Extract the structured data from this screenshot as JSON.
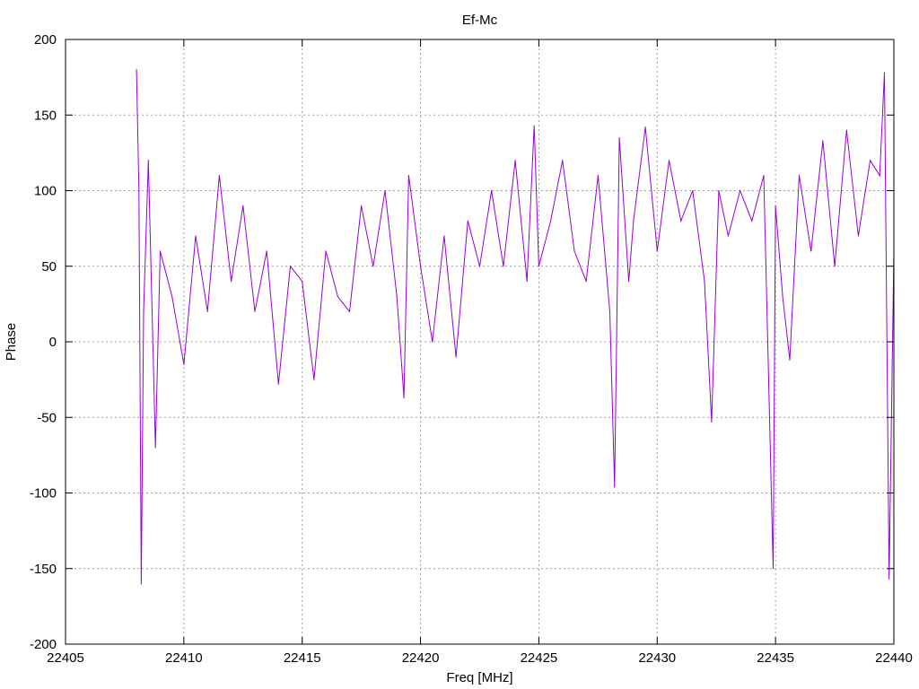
{
  "chart_data": {
    "type": "line",
    "title": "Ef-Mc",
    "xlabel": "Freq [MHz]",
    "ylabel": "Phase",
    "xlim": [
      22405,
      22440
    ],
    "ylim": [
      -200,
      200
    ],
    "xticks": [
      22405,
      22410,
      22415,
      22420,
      22425,
      22430,
      22435,
      22440
    ],
    "yticks": [
      -200,
      -150,
      -100,
      -50,
      0,
      50,
      100,
      150,
      200
    ],
    "xtick_labels": [
      "22405",
      "22410",
      "22415",
      "22420",
      "22425",
      "22430",
      "22435",
      "22440"
    ],
    "ytick_labels": [
      "-200",
      "-150",
      "-100",
      "-50",
      "0",
      "50",
      "100",
      "150",
      "200"
    ],
    "grid": true,
    "line_color": "#9400d3",
    "series": [
      {
        "x": [
          22408.0,
          22408.1,
          22408.2,
          22408.3,
          22408.5,
          22408.8,
          22409.0,
          22409.5,
          22410.0,
          22410.5,
          22411.0,
          22411.5,
          22412.0,
          22412.5,
          22413.0,
          22413.5,
          22414.0,
          22414.5,
          22415.0,
          22415.5,
          22416.0,
          22416.5,
          22417.0,
          22417.5,
          22418.0,
          22418.5,
          22419.0,
          22419.3,
          22419.5,
          22420.0,
          22420.5,
          22421.0,
          22421.5,
          22422.0,
          22422.5,
          22423.0,
          22423.5,
          22424.0,
          22424.5,
          22424.8,
          22425.0,
          22425.5,
          22426.0,
          22426.5,
          22427.0,
          22427.5,
          22428.0,
          22428.2,
          22428.4,
          22428.8,
          22429.0,
          22429.5,
          22430.0,
          22430.5,
          22431.0,
          22431.5,
          22432.0,
          22432.3,
          22432.6,
          22433.0,
          22433.5,
          22434.0,
          22434.5,
          22434.9,
          22435.0,
          22435.3,
          22435.6,
          22436.0,
          22436.5,
          22437.0,
          22437.5,
          22438.0,
          22438.5,
          22439.0,
          22439.4,
          22439.6,
          22439.8,
          22440.0
        ],
        "y": [
          180,
          100,
          -160,
          20,
          120,
          -70,
          60,
          30,
          -15,
          70,
          20,
          110,
          40,
          90,
          20,
          60,
          -28,
          50,
          40,
          -25,
          60,
          30,
          20,
          90,
          50,
          100,
          30,
          -37,
          110,
          50,
          0,
          70,
          -10,
          80,
          50,
          100,
          50,
          120,
          40,
          143,
          50,
          80,
          120,
          60,
          40,
          110,
          20,
          -96,
          135,
          40,
          80,
          142,
          60,
          120,
          80,
          100,
          40,
          -53,
          100,
          70,
          100,
          80,
          110,
          -150,
          90,
          30,
          -12,
          110,
          60,
          133,
          50,
          140,
          70,
          120,
          110,
          178,
          -157,
          60
        ]
      }
    ]
  }
}
